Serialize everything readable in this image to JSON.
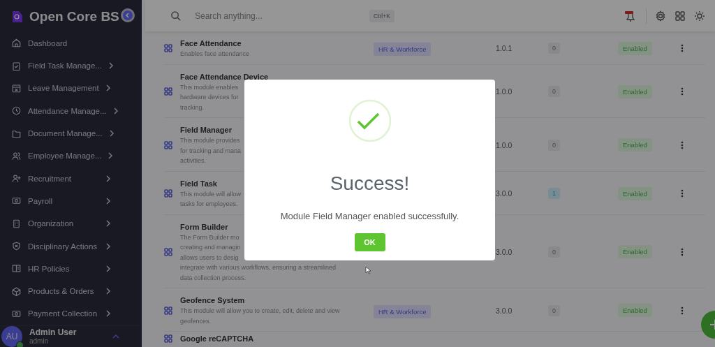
{
  "sidebar": {
    "brand": "Open Core BS",
    "items": [
      {
        "label": "Dashboard",
        "has_submenu": false
      },
      {
        "label": "Field Task Manage...",
        "has_submenu": true
      },
      {
        "label": "Leave Management",
        "has_submenu": true
      },
      {
        "label": "Attendance Manage...",
        "has_submenu": true
      },
      {
        "label": "Document Manage...",
        "has_submenu": true
      },
      {
        "label": "Employee Manage...",
        "has_submenu": true
      },
      {
        "label": "Recruitment",
        "has_submenu": true
      },
      {
        "label": "Payroll",
        "has_submenu": true
      },
      {
        "label": "Organization",
        "has_submenu": true
      },
      {
        "label": "Disciplinary Actions",
        "has_submenu": true
      },
      {
        "label": "HR Policies",
        "has_submenu": true
      },
      {
        "label": "Products & Orders",
        "has_submenu": true
      },
      {
        "label": "Payment Collection",
        "has_submenu": true
      }
    ],
    "user": {
      "initials": "AU",
      "name": "Admin User",
      "role": "admin",
      "online": true
    }
  },
  "header": {
    "search_placeholder": "Search anything...",
    "shortcut": "Ctrl+K"
  },
  "modules": [
    {
      "name": "Face Attendance",
      "description": [
        "Enables face attendance"
      ],
      "category": "HR & Workforce",
      "version": "1.0.1",
      "count": "0",
      "count_highlighted": false,
      "status": "Enabled"
    },
    {
      "name": "Face Attendance Device",
      "description": [
        "This module enables",
        "hardware devices for",
        "tracking."
      ],
      "version": "1.0.0",
      "count": "0",
      "count_highlighted": false,
      "status": "Enabled"
    },
    {
      "name": "Field Manager",
      "description": [
        "This module provides",
        "for tracking and mana",
        "activities."
      ],
      "version": "1.0.0",
      "count": "0",
      "count_highlighted": false,
      "status": "Enabled"
    },
    {
      "name": "Field Task",
      "description": [
        "This module will allow",
        "tasks for employees."
      ],
      "version": "3.0.0",
      "count": "1",
      "count_highlighted": true,
      "status": "Enabled"
    },
    {
      "name": "Form Builder",
      "description": [
        "The Form Builder mo",
        "creating and managin",
        "allows users to desig",
        "integrate with various workflows, ensuring a streamlined",
        "data collection process."
      ],
      "version": "3.0.0",
      "count": "0",
      "count_highlighted": false,
      "status": "Enabled"
    },
    {
      "name": "Geofence System",
      "description": [
        "This module will allow you to create, edit, delete and view",
        "geofences."
      ],
      "category": "HR & Workforce",
      "version": "3.0.0",
      "count": "0",
      "count_highlighted": false,
      "status": "Enabled"
    },
    {
      "name": "Google reCAPTCHA"
    }
  ],
  "dialog": {
    "title": "Success!",
    "message": "Module Field Manager enabled successfully.",
    "button": "OK"
  }
}
